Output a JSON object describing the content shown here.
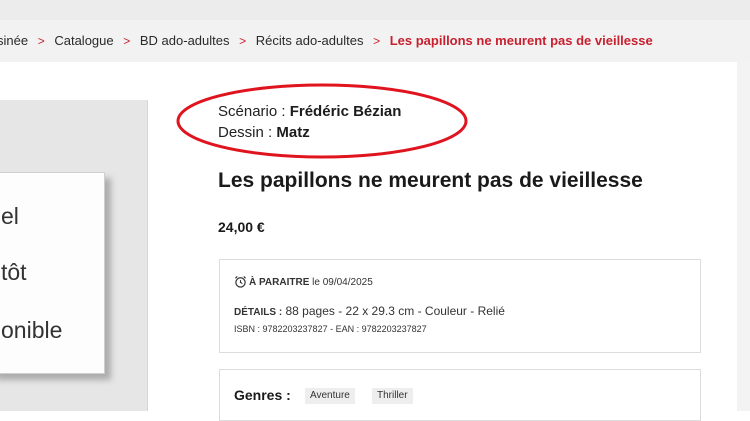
{
  "breadcrumb": {
    "items": [
      "sinée",
      "Catalogue",
      "BD ado-adultes",
      "Récits ado-adultes"
    ],
    "current": "Les papillons ne meurent pas de vieillesse",
    "separator": ">"
  },
  "cover": {
    "lines": [
      "el",
      "tôt",
      "onible"
    ]
  },
  "authors": {
    "scenario_label": "Scénario : ",
    "scenario_name": "Frédéric Bézian",
    "dessin_label": "Dessin : ",
    "dessin_name": "Matz"
  },
  "product": {
    "title": "Les papillons ne meurent pas de vieillesse",
    "price": "24,00 €"
  },
  "details": {
    "release_icon": "alarm-clock-icon",
    "release_status": "À PARAITRE",
    "release_date": "le 09/04/2025",
    "details_label": "DÉTAILS :",
    "details_value": "88 pages - 22 x 29.3 cm - Couleur - Relié",
    "isbn_line": "ISBN : 9782203237827 - EAN : 9782203237827"
  },
  "genres": {
    "label": "Genres :",
    "tags": [
      "Aventure",
      "Thriller"
    ]
  },
  "colors": {
    "accent": "#c8202f",
    "annotation_ellipse": "#e0141e"
  }
}
